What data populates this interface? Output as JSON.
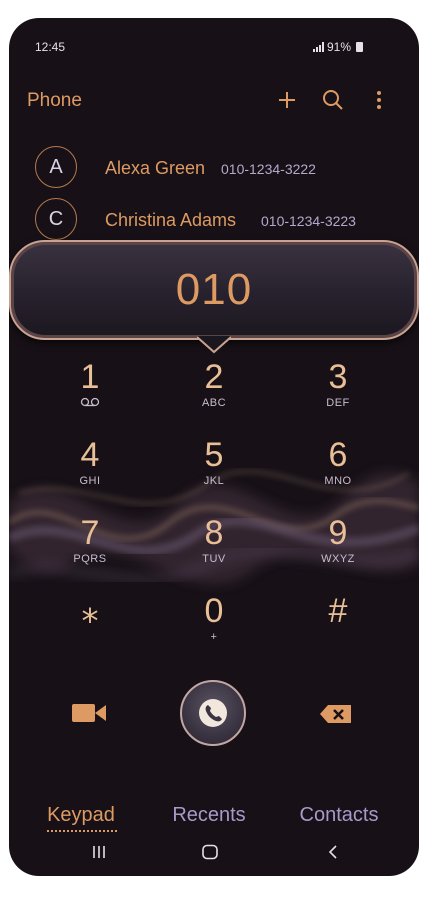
{
  "status_bar": {
    "time": "12:45",
    "battery": "91%"
  },
  "app_bar": {
    "title": "Phone"
  },
  "contacts": [
    {
      "initial": "A",
      "name": "Alexa Green",
      "number": "010-1234-3222"
    },
    {
      "initial": "C",
      "name": "Christina Adams",
      "number": "010-1234-3223"
    }
  ],
  "dialed_number": "010",
  "keypad": [
    {
      "digit": "1",
      "letters": ""
    },
    {
      "digit": "2",
      "letters": "ABC"
    },
    {
      "digit": "3",
      "letters": "DEF"
    },
    {
      "digit": "4",
      "letters": "GHI"
    },
    {
      "digit": "5",
      "letters": "JKL"
    },
    {
      "digit": "6",
      "letters": "MNO"
    },
    {
      "digit": "7",
      "letters": "PQRS"
    },
    {
      "digit": "8",
      "letters": "TUV"
    },
    {
      "digit": "9",
      "letters": "WXYZ"
    },
    {
      "digit": "⁎",
      "letters": ""
    },
    {
      "digit": "0",
      "letters": "+"
    },
    {
      "digit": "#",
      "letters": ""
    }
  ],
  "tabs": {
    "keypad": "Keypad",
    "recents": "Recents",
    "contacts": "Contacts"
  },
  "icons": {
    "add": "plus-icon",
    "search": "search-icon",
    "more": "more-vertical-icon",
    "voicemail": "voicemail-icon",
    "video": "video-call-icon",
    "call": "phone-icon",
    "delete": "backspace-icon",
    "recent_apps": "recent-apps-icon",
    "home": "home-icon",
    "back": "back-icon"
  },
  "colors": {
    "accent": "#dd9a62",
    "secondary": "#a79ac9",
    "background": "#171117"
  }
}
